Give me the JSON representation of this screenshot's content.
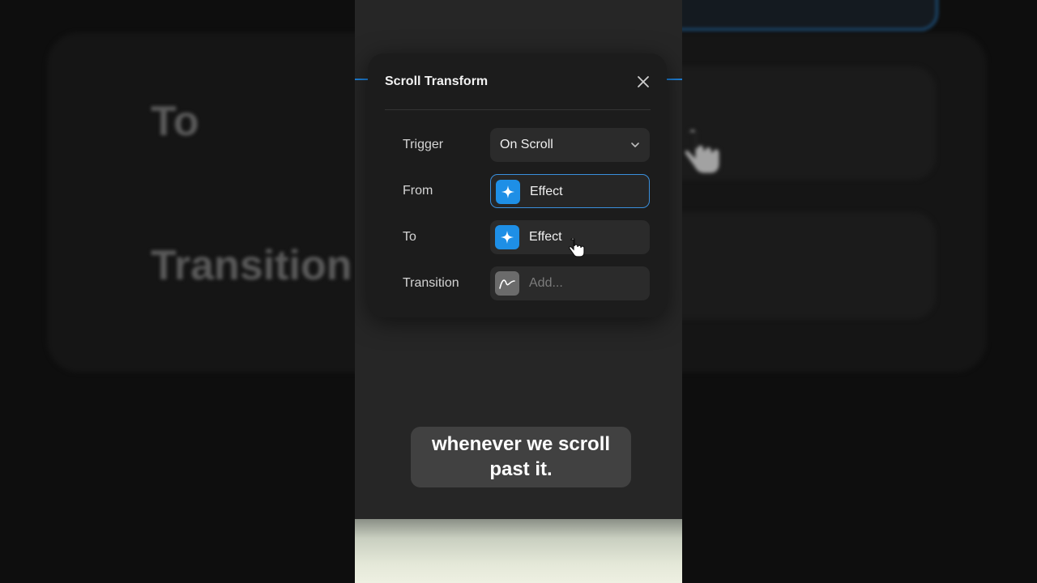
{
  "panel": {
    "title": "Scroll Transform",
    "close_icon": "close-icon"
  },
  "rows": [
    {
      "label": "Trigger",
      "value": "On Scroll",
      "type": "dropdown",
      "icon": "chevron-down-icon"
    },
    {
      "label": "From",
      "value": "Effect",
      "type": "effect",
      "icon": "sparkle-icon",
      "selected": true
    },
    {
      "label": "To",
      "value": "Effect",
      "type": "effect",
      "icon": "sparkle-icon"
    },
    {
      "label": "Transition",
      "value": "Add...",
      "type": "placeholder",
      "icon": "curve-icon"
    }
  ],
  "caption": {
    "line1": "whenever we scroll",
    "line2": "past it."
  },
  "background": {
    "label_to": "To",
    "label_transition": "Transition"
  },
  "colors": {
    "accent": "#1e8fe6",
    "selected_border": "#3a8fdc",
    "panel_bg": "#1c1c1c"
  }
}
